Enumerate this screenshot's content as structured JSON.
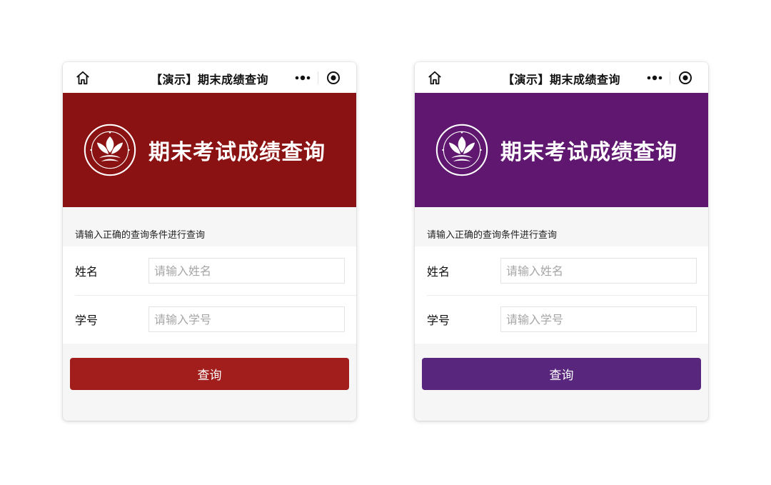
{
  "colors": {
    "red_banner": "#8b1212",
    "red_button": "#a11e1c",
    "purple_banner": "#5f176f",
    "purple_button": "#58267d"
  },
  "screens": [
    {
      "theme": "red",
      "nav": {
        "title": "【演示】期末成绩查询",
        "home_icon": "home-icon",
        "more_icon": "more-dots-icon",
        "close_icon": "target-circle-icon"
      },
      "banner": {
        "title": "期末考试成绩查询",
        "logo_icon": "school-emblem"
      },
      "form": {
        "hint": "请输入正确的查询条件进行查询",
        "name_label": "姓名",
        "name_placeholder": "请输入姓名",
        "id_label": "学号",
        "id_placeholder": "请输入学号"
      },
      "submit_label": "查询"
    },
    {
      "theme": "purple",
      "nav": {
        "title": "【演示】期末成绩查询",
        "home_icon": "home-icon",
        "more_icon": "more-dots-icon",
        "close_icon": "target-circle-icon"
      },
      "banner": {
        "title": "期末考试成绩查询",
        "logo_icon": "school-emblem"
      },
      "form": {
        "hint": "请输入正确的查询条件进行查询",
        "name_label": "姓名",
        "name_placeholder": "请输入姓名",
        "id_label": "学号",
        "id_placeholder": "请输入学号"
      },
      "submit_label": "查询"
    }
  ]
}
